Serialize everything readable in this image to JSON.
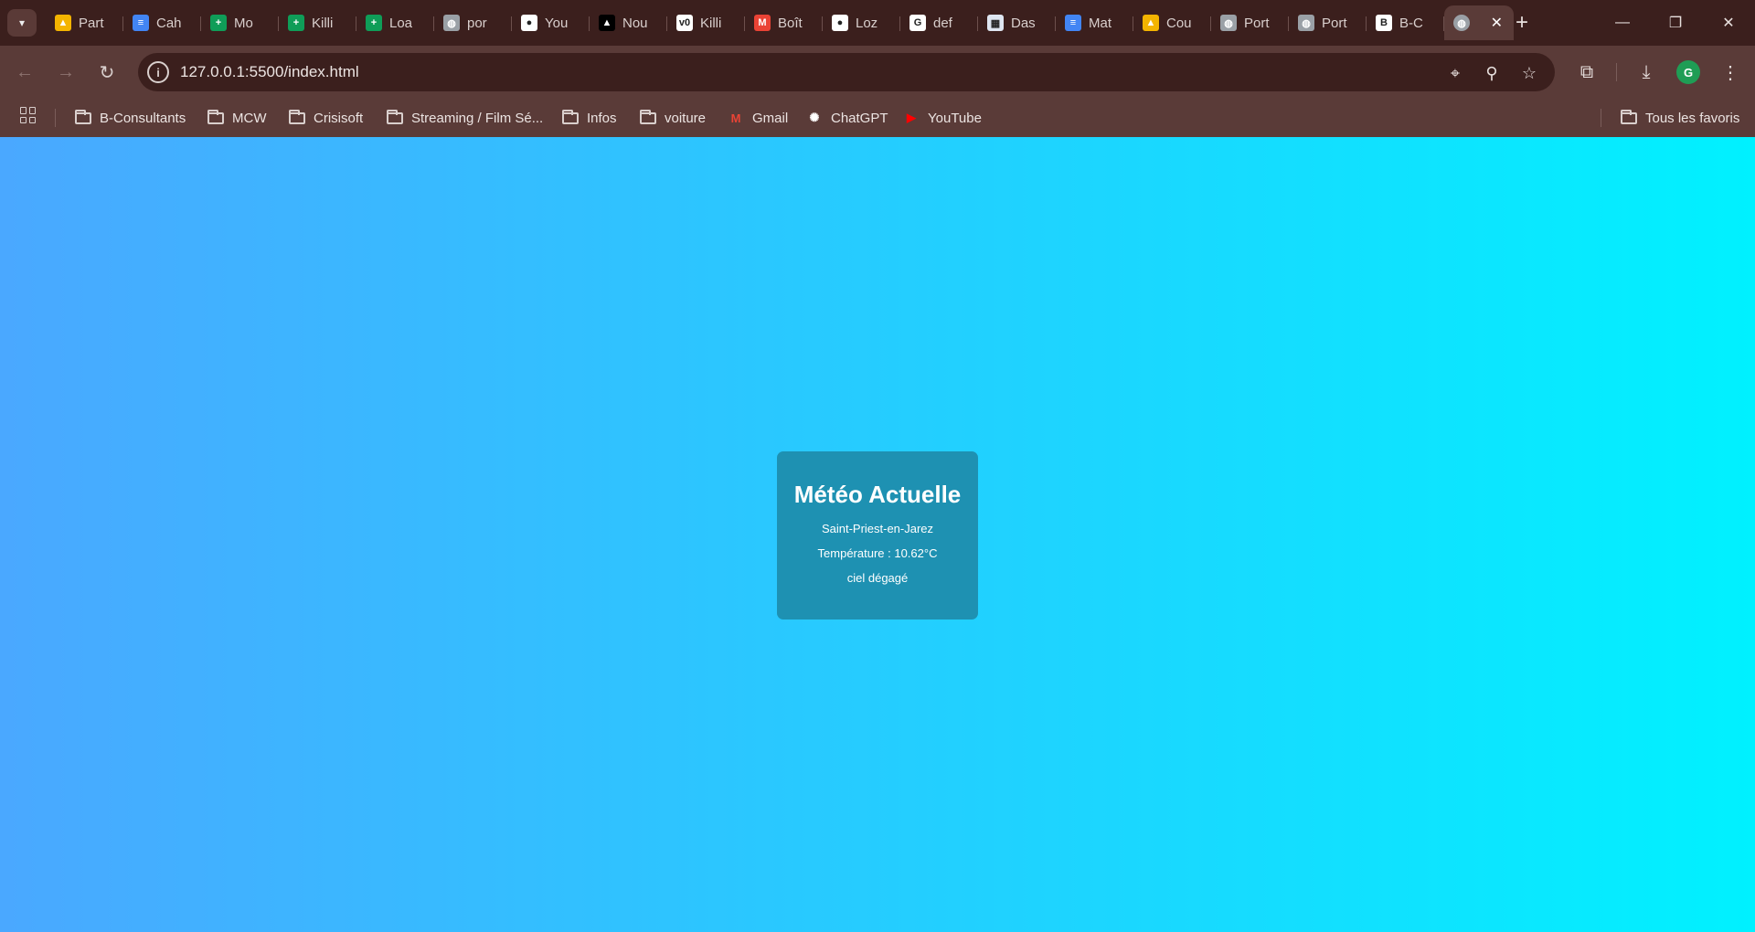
{
  "browser": {
    "tabs": [
      {
        "label": "Part",
        "icon": "google-drive-icon",
        "color": "#f4b400"
      },
      {
        "label": "Cah",
        "icon": "google-docs-icon",
        "color": "#4285f4"
      },
      {
        "label": "Mo",
        "icon": "google-sheets-icon",
        "color": "#0f9d58"
      },
      {
        "label": "Killi",
        "icon": "google-sheets-icon",
        "color": "#0f9d58"
      },
      {
        "label": "Loa",
        "icon": "google-sheets-icon",
        "color": "#0f9d58"
      },
      {
        "label": "por",
        "icon": "globe-icon",
        "color": "#9aa0a6"
      },
      {
        "label": "You",
        "icon": "github-icon",
        "color": "#ffffff"
      },
      {
        "label": "Nou",
        "icon": "triangle-icon",
        "color": "#000000"
      },
      {
        "label": "Killi",
        "icon": "v0-icon",
        "color": "#ffffff"
      },
      {
        "label": "Boît",
        "icon": "gmail-icon",
        "color": "#ea4335"
      },
      {
        "label": "Loz",
        "icon": "github-icon",
        "color": "#ffffff"
      },
      {
        "label": "def",
        "icon": "google-icon",
        "color": "#ffffff"
      },
      {
        "label": "Das",
        "icon": "calendar-grid-icon",
        "color": "#dfe6f1"
      },
      {
        "label": "Mat",
        "icon": "google-docs-icon",
        "color": "#4285f4"
      },
      {
        "label": "Cou",
        "icon": "google-drive-icon",
        "color": "#f4b400"
      },
      {
        "label": "Port",
        "icon": "globe-icon",
        "color": "#9aa0a6"
      },
      {
        "label": "Port",
        "icon": "globe-icon",
        "color": "#9aa0a6"
      },
      {
        "label": "B-C",
        "icon": "b-consultants-icon",
        "color": "#ffffff"
      }
    ],
    "active_tab": {
      "icon": "globe-icon"
    },
    "address_bar": {
      "url": "127.0.0.1:5500/index.html"
    },
    "bookmarks": [
      {
        "label": "B-Consultants",
        "icon": "folder-icon"
      },
      {
        "label": "MCW",
        "icon": "folder-icon"
      },
      {
        "label": "Crisisoft",
        "icon": "folder-icon"
      },
      {
        "label": "Streaming / Film Sé...",
        "icon": "folder-icon"
      },
      {
        "label": "Infos",
        "icon": "folder-icon"
      },
      {
        "label": "voiture",
        "icon": "folder-icon"
      },
      {
        "label": "Gmail",
        "icon": "gmail-icon"
      },
      {
        "label": "ChatGPT",
        "icon": "chatgpt-icon"
      },
      {
        "label": "YouTube",
        "icon": "youtube-icon"
      }
    ],
    "all_bookmarks": "Tous les favoris"
  },
  "weather": {
    "title": "Météo Actuelle",
    "city": "Saint-Priest-en-Jarez",
    "temperature": "Température : 10.62°C",
    "description": "ciel dégagé"
  },
  "colors": {
    "gradient_start": "#4aa8ff",
    "gradient_end": "#00f1ff",
    "card_bg": "#1e91b2"
  }
}
